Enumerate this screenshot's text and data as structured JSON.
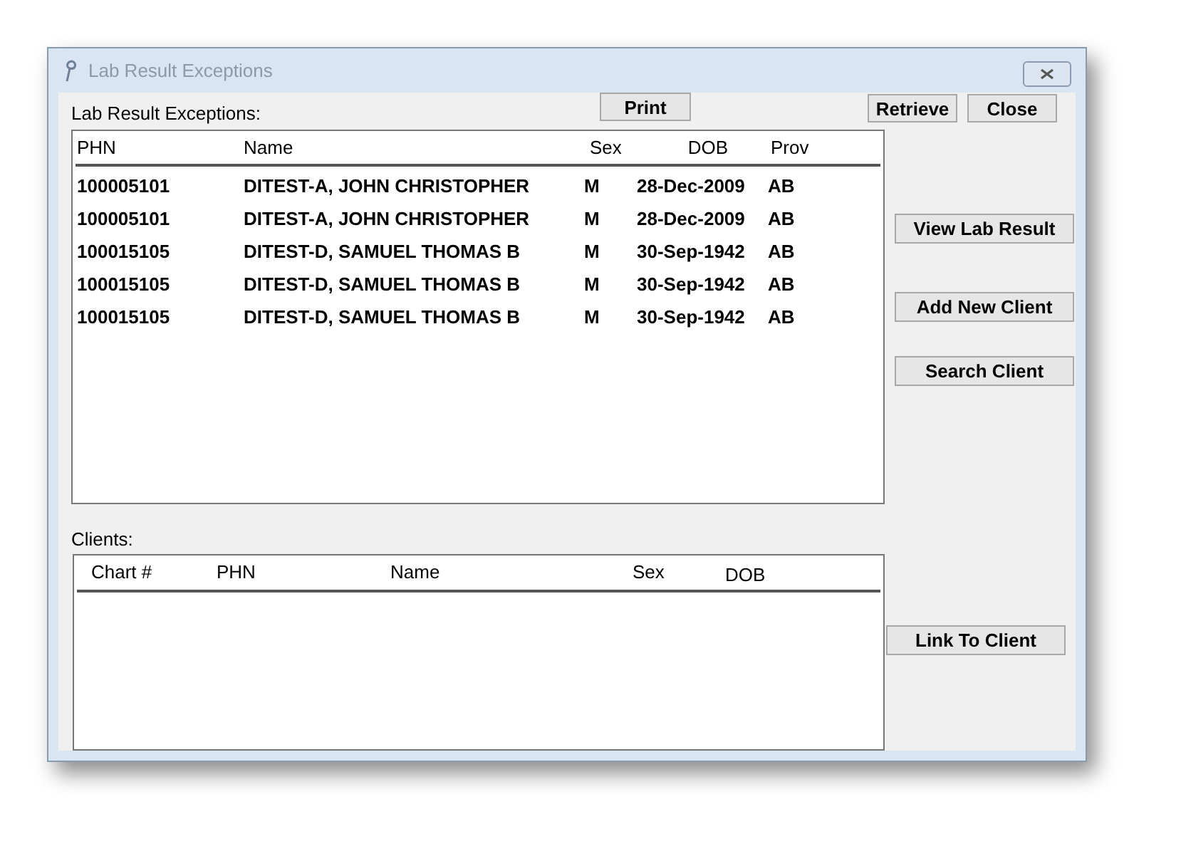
{
  "window": {
    "title": "Lab Result Exceptions"
  },
  "exceptions": {
    "label": "Lab Result Exceptions:",
    "columns": [
      "PHN",
      "Name",
      "Sex",
      "DOB",
      "Prov"
    ],
    "rows": [
      [
        "100005101",
        "DITEST-A, JOHN CHRISTOPHER",
        "M",
        "28-Dec-2009",
        "AB"
      ],
      [
        "100005101",
        "DITEST-A, JOHN CHRISTOPHER",
        "M",
        "28-Dec-2009",
        "AB"
      ],
      [
        "100015105",
        "DITEST-D, SAMUEL THOMAS B",
        "M",
        "30-Sep-1942",
        "AB"
      ],
      [
        "100015105",
        "DITEST-D, SAMUEL THOMAS B",
        "M",
        "30-Sep-1942",
        "AB"
      ],
      [
        "100015105",
        "DITEST-D, SAMUEL THOMAS B",
        "M",
        "30-Sep-1942",
        "AB"
      ]
    ]
  },
  "print_button": "Print",
  "top_buttons": [
    "Retrieve",
    "Close"
  ],
  "side_buttons": [
    "View Lab Result",
    "Add New Client",
    "Search Client"
  ],
  "clients": {
    "label": "Clients:",
    "columns": [
      "Chart #",
      "PHN",
      "Name",
      "Sex",
      "DOB"
    ]
  },
  "link_button": "Link To Client"
}
